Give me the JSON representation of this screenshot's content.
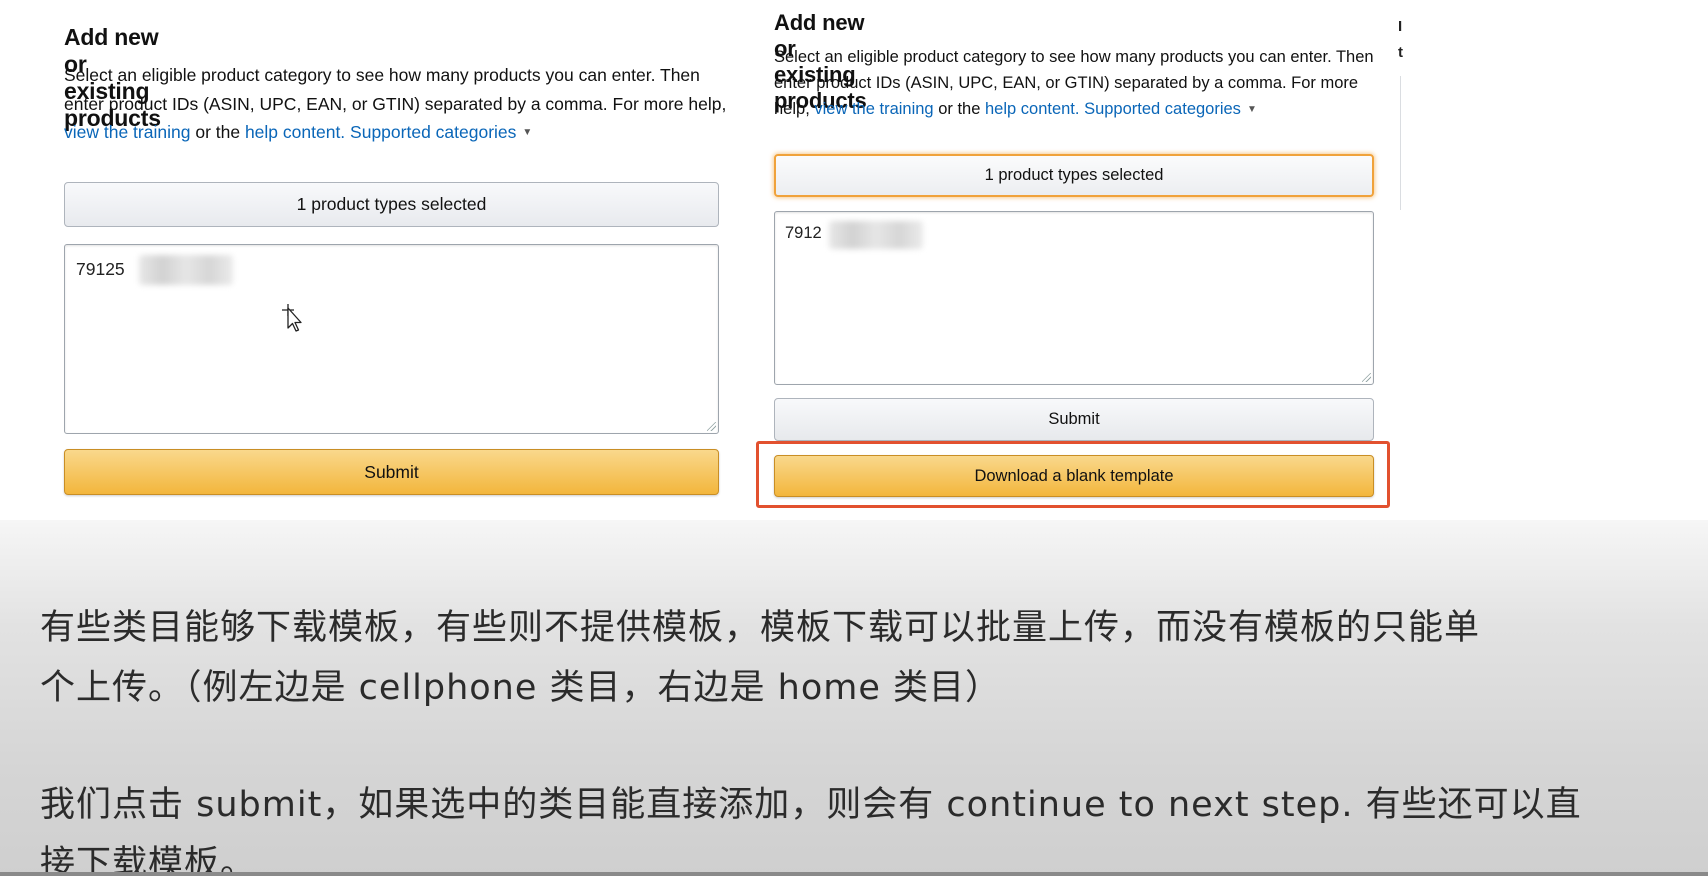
{
  "left_panel": {
    "title": "Add new or existing products",
    "desc_text": "Select an eligible product category to see how many products you can enter. Then enter product IDs (ASIN, UPC, EAN, or GTIN) separated by a comma. For more help, ",
    "link_training": "view the training",
    "or_the": " or the ",
    "link_help": "help content.",
    "link_categories": "Supported categories",
    "type_selector_label": "1 product types selected",
    "product_id_value": "79125",
    "submit_label": "Submit"
  },
  "right_panel": {
    "title": "Add new or existing products",
    "desc_text": "Select an eligible product category to see how many products you can enter. Then enter product IDs (ASIN, UPC, EAN, or GTIN) separated by a comma. For more help, ",
    "link_training": "view the training",
    "or_the": " or the ",
    "link_help": "help content.",
    "link_categories": "Supported categories",
    "type_selector_label": "1 product types selected",
    "product_id_value": "7912",
    "submit_label": "Submit",
    "download_label": "Download a blank template"
  },
  "edge_column": {
    "char1": "I",
    "char2": "t"
  },
  "subtitles": {
    "line1": "有些类目能够下载模板，有些则不提供模板，模板下载可以批量上传，而没有模板的只能单",
    "line2": "个上传。（例左边是 cellphone 类目，右边是 home 类目）",
    "line3": "我们点击 submit，如果选中的类目能直接添加，则会有 continue to next step. 有些还可以直",
    "line4": "接下载模板。"
  },
  "colors": {
    "link": "#0a66b8",
    "primary_button": "#f3b63c",
    "highlight": "#e2512f",
    "focus": "#f0a23b"
  }
}
